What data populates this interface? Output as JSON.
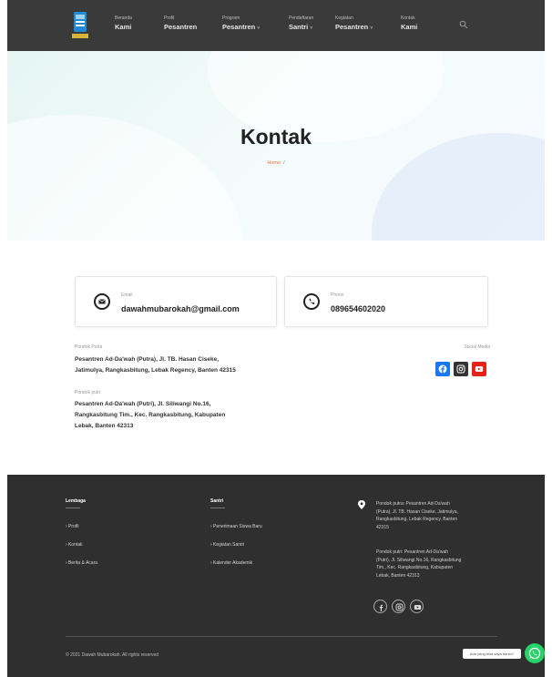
{
  "nav": {
    "items": [
      {
        "small": "Beranda",
        "label": "Kami",
        "caret": false
      },
      {
        "small": "Profil",
        "label": "Pesantren",
        "caret": false
      },
      {
        "small": "Program",
        "label": "Pesantren",
        "caret": true
      },
      {
        "small": "Pendaftaran",
        "label": "Santri",
        "caret": true
      },
      {
        "small": "Kegiatan",
        "label": "Pesantren",
        "caret": true
      },
      {
        "small": "Kontak",
        "label": "Kami",
        "caret": false
      }
    ],
    "caret_glyph": "˅",
    "search_icon": "search-icon"
  },
  "hero": {
    "title": "Kontak",
    "breadcrumb_home": "Home",
    "breadcrumb_sep": "/"
  },
  "contact": {
    "email_label": "Email",
    "email_value": "dawahmubarokah@gmail.com",
    "phone_label": "Phone",
    "phone_value": "089654602020"
  },
  "address": {
    "putra_label": "Pondok Putra",
    "putra_line1": "Pesantren Ad-Da'wah (Putra), Jl. TB. Hasan Ciseke,",
    "putra_line2": "Jatimulya, Rangkasbitung, Lebak Regency, Banten 42315",
    "putri_label": "Pondok putri",
    "putri_line1": "Pesantren Ad-Da'wah (Putri), Jl. Siliwangi No.16,",
    "putri_line2": "Rangkasbitung Tim., Kec. Rangkasbitung, Kabupaten",
    "putri_line3": "Lebak, Banten 42313"
  },
  "social": {
    "label": "Social Media",
    "colors": {
      "facebook": "#1877f2",
      "instagram": "#333333",
      "youtube": "#e62117"
    }
  },
  "footer": {
    "col1_title": "Lembaga",
    "col1_links": [
      "› Profil",
      "› Kontak",
      "› Berita & Acara"
    ],
    "col2_title": "Santri",
    "col2_links": [
      "› Penerimaan Siswa Baru",
      "› Kegiatan Santri",
      "› Kalender Akademik"
    ],
    "addr_putra": [
      "Pondok putra: Pesantren Ad-Da'wah",
      "(Putra), Jl. TB. Hasan Ciseke, Jatimulya,",
      "Rangkasbitung, Lebak Regency, Banten",
      "42315"
    ],
    "addr_putri": [
      "Pondok putri: Pesantren Ad-Da'wah",
      "(Putri), Jl. Siliwangi No.16, Rangkasbitung",
      "Tim., Kec. Rangkasbitung, Kabupaten",
      "Lebak, Banten 42313"
    ],
    "copyright": "© 2021 Dawah Mubarokah. All rights reserved"
  },
  "chat": {
    "tooltip": "Ada yang bisa saya bantu?"
  },
  "colors": {
    "nav_bg": "#3a3a3a",
    "accent": "#e8703a",
    "footer_bg": "#2f2f2f",
    "whatsapp": "#25d366"
  }
}
